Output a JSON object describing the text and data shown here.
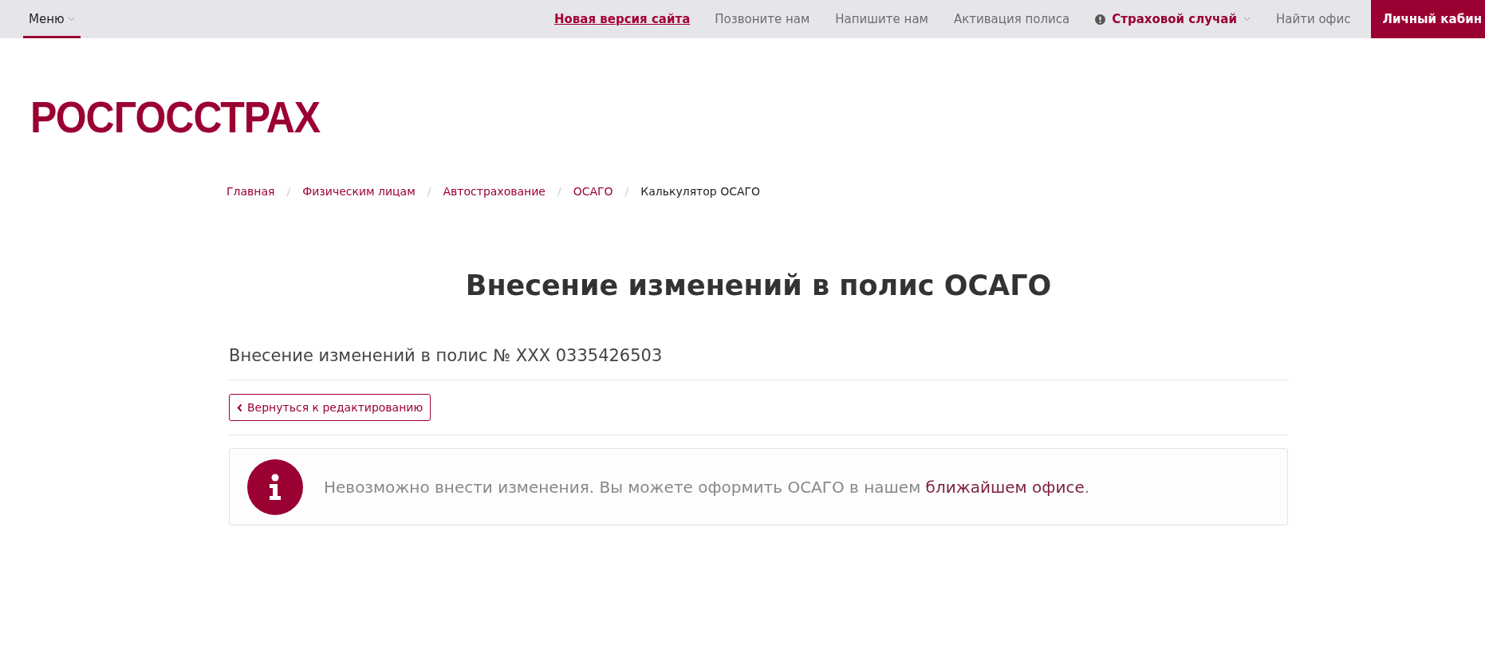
{
  "topbar": {
    "menu": {
      "label": "Меню",
      "selected": true
    },
    "links": [
      {
        "label": "Новая версия сайта",
        "kind": "highlight"
      },
      {
        "label": "Позвоните нам",
        "kind": "plain"
      },
      {
        "label": "Напишите нам",
        "kind": "plain"
      },
      {
        "label": "Активация полиса",
        "kind": "plain"
      },
      {
        "label": "Страховой случай",
        "kind": "alert"
      },
      {
        "label": "Найти офис",
        "kind": "plain"
      },
      {
        "label": "Личный кабин",
        "kind": "primary"
      }
    ]
  },
  "logo": "РОСГОССТРАХ",
  "breadcrumbs": [
    {
      "label": "Главная",
      "current": false
    },
    {
      "label": "Физическим лицам",
      "current": false
    },
    {
      "label": "Автострахование",
      "current": false
    },
    {
      "label": "ОСАГО",
      "current": false
    },
    {
      "label": "Калькулятор ОСАГО",
      "current": true
    }
  ],
  "breadcrumb_separator": "/",
  "title": "Внесение изменений в полис ОСАГО",
  "subtitle": "Внесение изменений в полис № XXX 0335426503",
  "back_button": "Вернуться к редактированию",
  "alert": {
    "text": "Невозможно внести изменения. Вы можете оформить ОСАГО в нашем",
    "link": "ближайшем офисе",
    "after": "."
  }
}
